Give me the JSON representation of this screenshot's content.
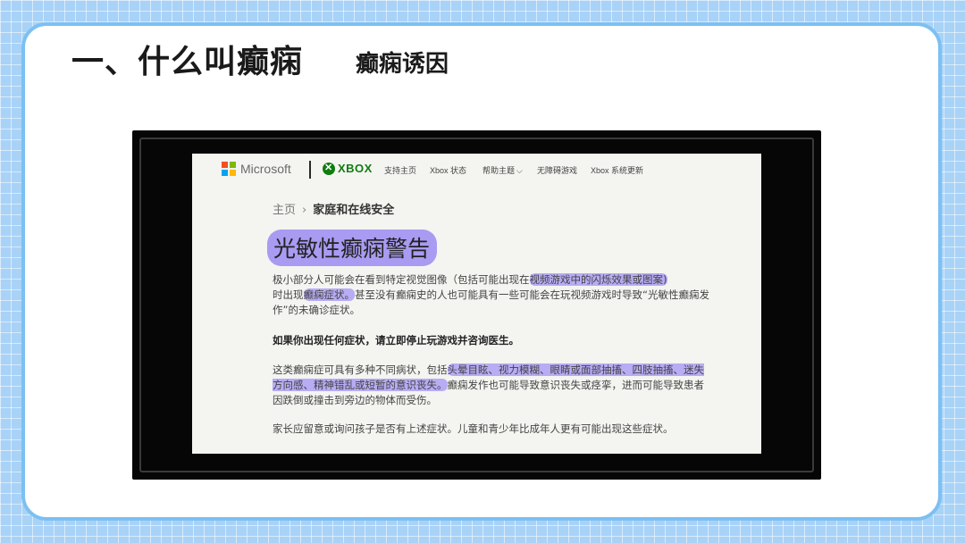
{
  "slide": {
    "title": "一、什么叫癫痫",
    "subtitle": "癫痫诱因"
  },
  "webpage": {
    "nav": {
      "microsoft_logo": "Microsoft",
      "xbox_logo": "XBOX",
      "links": [
        "支持主页",
        "Xbox 状态",
        "帮助主题",
        "无障碍游戏",
        "Xbox 系统更新"
      ]
    },
    "breadcrumb": {
      "home": "主页",
      "current": "家庭和在线安全"
    },
    "heading": "光敏性癫痫警告",
    "paragraphs": {
      "p1": {
        "a": "极小部分人可能会在看到特定视觉图像（包括可能出现在",
        "b": "视频游戏中的闪烁效果或图案)",
        "c": "时出现",
        "d": "癫痫症状。",
        "e": "甚至没有癫痫史的人也可能具有一些可能会在玩视频游戏时导致“光敏性癫痫发作”的未确诊症状。"
      },
      "p2": "如果你出现任何症状，请立即停止玩游戏并咨询医生。",
      "p3": {
        "a": "这类癫痫症可具有多种不同病状，包括",
        "b": "头晕目眩、视力模糊、眼睛或面部抽搐、四肢抽搐、迷失方向感、精神错乱或短暂的意识丧失。",
        "c": "癫痫发作也可能导致意识丧失或痉挛，进而可能导致患者因跌倒或撞击到旁边的物体而受伤。"
      },
      "p4": "家长应留意或询问孩子是否有上述症状。儿童和青少年比成年人更有可能出现这些症状。"
    }
  },
  "colors": {
    "background": "#a9d2f7",
    "card_border": "#7cc0f2",
    "highlight": "#b8acf4",
    "heading_highlight": "#a99bf2",
    "xbox_green": "#107c10",
    "ms_red": "#f25022",
    "ms_green": "#7fba00",
    "ms_blue": "#00a4ef",
    "ms_yellow": "#ffb900"
  },
  "icons": {
    "microsoft": "microsoft-logo-icon",
    "xbox": "xbox-logo-icon",
    "chevron": "chevron-down-icon",
    "breadcrumb_sep": "chevron-right-icon"
  }
}
